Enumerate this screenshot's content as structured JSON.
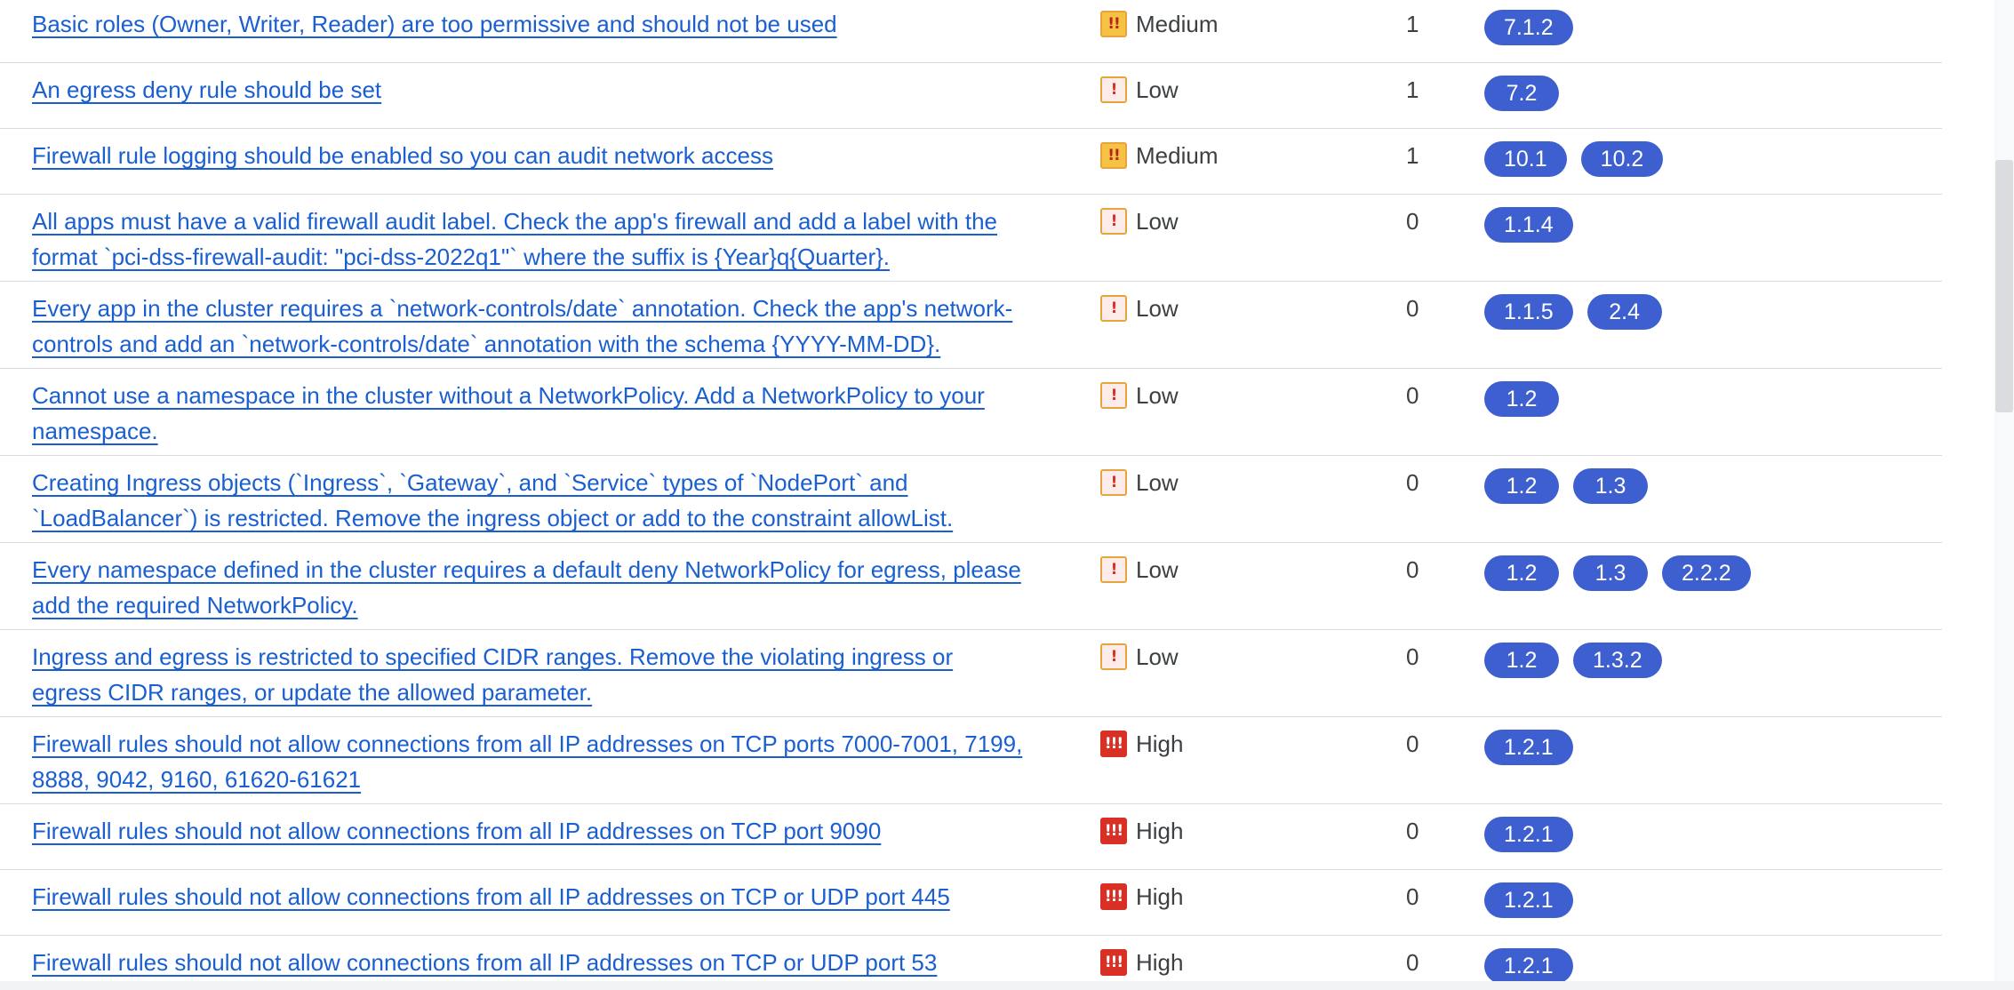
{
  "table": {
    "rows": [
      {
        "rule": "Basic roles (Owner, Writer, Reader) are too permissive and should not be used",
        "severity": "Medium",
        "severity_level": "medium",
        "severity_icon": "!!",
        "count": "1",
        "controls": [
          "7.1.2"
        ]
      },
      {
        "rule": "An egress deny rule should be set",
        "severity": "Low",
        "severity_level": "low",
        "severity_icon": "!",
        "count": "1",
        "controls": [
          "7.2"
        ]
      },
      {
        "rule": "Firewall rule logging should be enabled so you can audit network access",
        "severity": "Medium",
        "severity_level": "medium",
        "severity_icon": "!!",
        "count": "1",
        "controls": [
          "10.1",
          "10.2"
        ]
      },
      {
        "rule": "All apps must have a valid firewall audit label. Check the app's firewall and add a label with the format `pci-dss-firewall-audit: \"pci-dss-2022q1\"` where the suffix is {Year}q{Quarter}.",
        "severity": "Low",
        "severity_level": "low",
        "severity_icon": "!",
        "count": "0",
        "controls": [
          "1.1.4"
        ]
      },
      {
        "rule": "Every app in the cluster requires a `network-controls/date` annotation. Check the app's network-controls and add an `network-controls/date` annotation with the schema {YYYY-MM-DD}.",
        "severity": "Low",
        "severity_level": "low",
        "severity_icon": "!",
        "count": "0",
        "controls": [
          "1.1.5",
          "2.4"
        ]
      },
      {
        "rule": "Cannot use a namespace in the cluster without a NetworkPolicy. Add a NetworkPolicy to your namespace.",
        "severity": "Low",
        "severity_level": "low",
        "severity_icon": "!",
        "count": "0",
        "controls": [
          "1.2"
        ]
      },
      {
        "rule": "Creating Ingress objects (`Ingress`, `Gateway`, and `Service` types of `NodePort` and `LoadBalancer`) is restricted. Remove the ingress object or add to the constraint allowList.",
        "severity": "Low",
        "severity_level": "low",
        "severity_icon": "!",
        "count": "0",
        "controls": [
          "1.2",
          "1.3"
        ]
      },
      {
        "rule": "Every namespace defined in the cluster requires a default deny NetworkPolicy for egress, please add the required NetworkPolicy.",
        "severity": "Low",
        "severity_level": "low",
        "severity_icon": "!",
        "count": "0",
        "controls": [
          "1.2",
          "1.3",
          "2.2.2"
        ]
      },
      {
        "rule": "Ingress and egress is restricted to specified CIDR ranges. Remove the violating ingress or egress CIDR ranges, or update the allowed parameter.",
        "severity": "Low",
        "severity_level": "low",
        "severity_icon": "!",
        "count": "0",
        "controls": [
          "1.2",
          "1.3.2"
        ]
      },
      {
        "rule": "Firewall rules should not allow connections from all IP addresses on TCP ports 7000-7001, 7199, 8888, 9042, 9160, 61620-61621",
        "severity": "High",
        "severity_level": "high",
        "severity_icon": "!!!",
        "count": "0",
        "controls": [
          "1.2.1"
        ]
      },
      {
        "rule": "Firewall rules should not allow connections from all IP addresses on TCP port 9090",
        "severity": "High",
        "severity_level": "high",
        "severity_icon": "!!!",
        "count": "0",
        "controls": [
          "1.2.1"
        ]
      },
      {
        "rule": "Firewall rules should not allow connections from all IP addresses on TCP or UDP port 445",
        "severity": "High",
        "severity_level": "high",
        "severity_icon": "!!!",
        "count": "0",
        "controls": [
          "1.2.1"
        ]
      },
      {
        "rule": "Firewall rules should not allow connections from all IP addresses on TCP or UDP port 53",
        "severity": "High",
        "severity_level": "high",
        "severity_icon": "!!!",
        "count": "0",
        "controls": [
          "1.2.1"
        ]
      }
    ]
  }
}
